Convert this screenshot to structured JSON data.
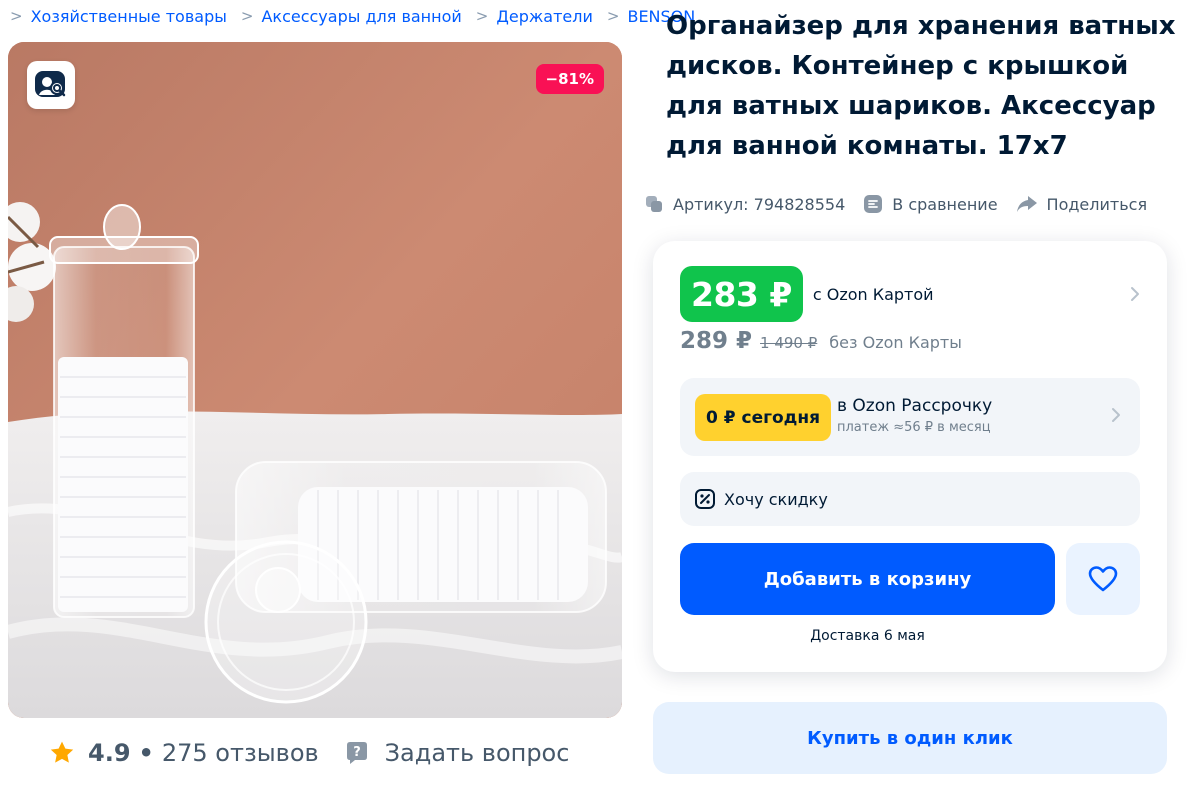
{
  "breadcrumb": [
    "Хозяйственные товары",
    "Аксессуары для ванной",
    "Держатели",
    "BENSON"
  ],
  "product": {
    "title": "Органайзер для хранения ватных дисков. Контейнер с крышкой для ватных шариков. Аксессуар для ванной комнаты. 17х7",
    "discount_badge": "−81%",
    "rating": "4.9",
    "rating_separator": "•",
    "reviews": "275 отзывов",
    "ask_question": "Задать вопрос"
  },
  "meta": {
    "article": "Артикул: 794828554",
    "compare": "В сравнение",
    "share": "Поделиться"
  },
  "price": {
    "ozon_card_price": "283 ₽",
    "ozon_card_label": "с Ozon Картой",
    "regular_price": "289 ₽",
    "old_price": "1 490 ₽",
    "regular_label": "без Ozon Карты"
  },
  "installment": {
    "badge": "0 ₽ сегодня",
    "title": "в Ozon Рассрочку",
    "subtitle": "платеж ≈56 ₽ в месяц"
  },
  "want_discount": "Хочу скидку",
  "buttons": {
    "add_to_cart": "Добавить в корзину",
    "buy_one_click": "Купить в один клик"
  },
  "delivery": "Доставка 6 мая",
  "colors": {
    "accent": "#005bff",
    "green_price": "#10c44c",
    "discount": "#f91155",
    "installment": "#ffd12e",
    "star": "#ffa800"
  },
  "icons": [
    "image-search-icon",
    "star-icon",
    "question-icon",
    "article-icon",
    "compare-icon",
    "share-icon",
    "chevron-right-icon",
    "percent-tag-icon",
    "heart-icon"
  ]
}
